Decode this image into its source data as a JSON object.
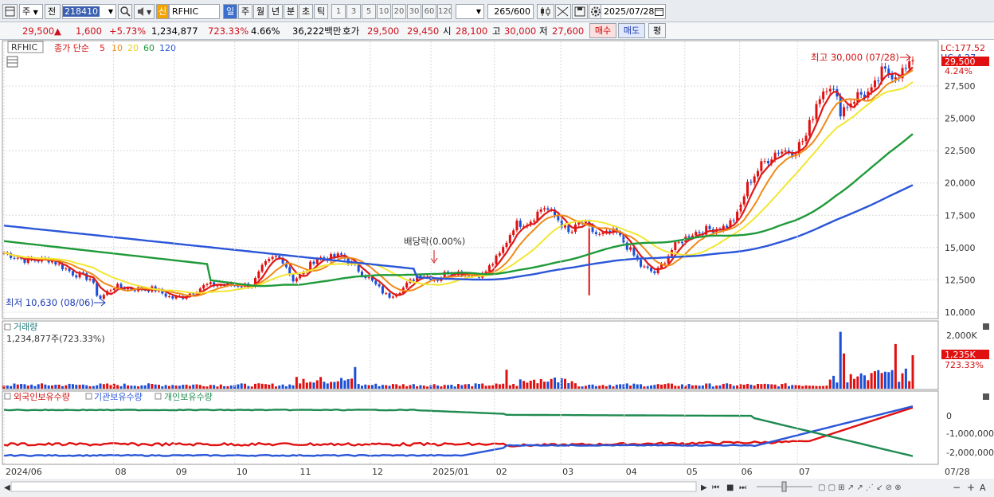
{
  "toolbar": {
    "market_label": "주",
    "prev_label": "전",
    "code": "218410",
    "new_badge": "신",
    "name": "RFHIC",
    "periods": [
      "일",
      "주",
      "월",
      "년",
      "분",
      "초",
      "틱"
    ],
    "active_period": "일",
    "intervals": [
      "1",
      "3",
      "5",
      "10",
      "20",
      "30",
      "60",
      "120"
    ],
    "count": "265",
    "count_total": "/600",
    "date": "2025/07/28",
    "icons": [
      "layout-icon",
      "dropdown-arrow-icon",
      "search-icon",
      "speaker-icon",
      "candlestick-icon",
      "crosshair-icon",
      "save-icon",
      "settings-icon",
      "calendar-icon"
    ]
  },
  "quote": {
    "price": "29,500",
    "change_arrow": "▲",
    "change": "1,600",
    "change_pct": "+5.73%",
    "volume": "1,234,877",
    "volume_ratio": "723.33%",
    "turnover": "4.66%",
    "amount": "36,222백만",
    "ask_label": "호가",
    "ask": "29,500",
    "bid": "29,450",
    "open_label": "시",
    "open": "28,100",
    "high_label": "고",
    "high": "30,000",
    "low_label": "저",
    "low": "27,600",
    "buy_label": "매수",
    "sell_label": "매도",
    "eval_label": "평"
  },
  "price_pane": {
    "tag": "RFHIC",
    "legend_title": "종가 단순",
    "ma_periods": [
      "5",
      "10",
      "20",
      "60",
      "120"
    ],
    "y_ticks": [
      "27,500",
      "25,000",
      "22,500",
      "20,000",
      "17,500",
      "15,000",
      "12,500",
      "10,000"
    ],
    "lc_label": "LC:177.52",
    "hc_label": "HC:4.27",
    "current_price": "29,500",
    "current_pct": "4.24%",
    "high_annotation": "최고 30,000 (07/28)",
    "low_annotation": "최저 10,630 (08/06)",
    "dividend_annotation": "배당락(0.00%)"
  },
  "volume_pane": {
    "title": "거래량",
    "value": "1,234,877주(723.33%)",
    "y_tick": "2,000K",
    "current": "1,235K",
    "current_pct": "723.33%"
  },
  "holdings_pane": {
    "legend": [
      "외국인보유수량",
      "기관보유수량",
      "개인보유수량"
    ],
    "y_ticks": [
      "0",
      "-1,000,000",
      "-2,000,000"
    ]
  },
  "xaxis": {
    "labels": [
      "2024/06",
      "08",
      "09",
      "10",
      "11",
      "12",
      "2025/01",
      "02",
      "03",
      "04",
      "05",
      "06",
      "07"
    ],
    "right_date": "07/28"
  },
  "colors": {
    "up": "#e01010",
    "down": "#1a4fd6",
    "ma5": "#e01818",
    "ma10": "#f08a18",
    "ma20": "#f2e630",
    "ma60": "#1f9a3a",
    "ma120": "#2a56d8",
    "foreign": "#e01010",
    "institution": "#2a56d8",
    "individual": "#1f8a50"
  }
}
